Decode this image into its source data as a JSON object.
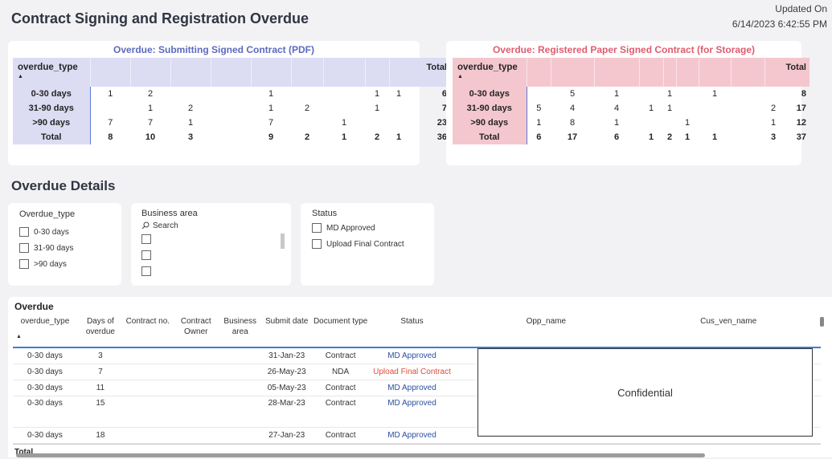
{
  "header": {
    "title": "Contract Signing and Registration Overdue",
    "updated_label": "Updated On",
    "updated_value": "6/14/2023 6:42:55 PM"
  },
  "colors": {
    "blue_header": "#dcdcf3",
    "pink_header": "#f4c7ce",
    "blue_title": "#5b6abf",
    "pink_title": "#e05c6e",
    "status_blue": "#2b4f9f",
    "status_red": "#e04b3a"
  },
  "matrix_pdf": {
    "title": "Overdue: Submitting Signed Contract (PDF)",
    "row_header": "overdue_type",
    "total_label": "Total",
    "rows": [
      {
        "label": "0-30 days",
        "cells": [
          "1",
          "2",
          "",
          "",
          "1",
          "",
          "",
          "1",
          "1"
        ],
        "total": "6"
      },
      {
        "label": "31-90 days",
        "cells": [
          "",
          "1",
          "2",
          "",
          "1",
          "2",
          "",
          "1",
          ""
        ],
        "total": "7"
      },
      {
        "label": ">90 days",
        "cells": [
          "7",
          "7",
          "1",
          "",
          "7",
          "",
          "1",
          "",
          ""
        ],
        "total": "23"
      },
      {
        "label": "Total",
        "cells": [
          "8",
          "10",
          "3",
          "",
          "9",
          "2",
          "1",
          "2",
          "1"
        ],
        "total": "36"
      }
    ]
  },
  "matrix_paper": {
    "title": "Overdue: Registered Paper Signed Contract (for Storage)",
    "row_header": "overdue_type",
    "total_label": "Total",
    "rows": [
      {
        "label": "0-30 days",
        "cells": [
          "",
          "5",
          "1",
          "",
          "1",
          "",
          "1",
          "",
          ""
        ],
        "total": "8"
      },
      {
        "label": "31-90 days",
        "cells": [
          "5",
          "4",
          "4",
          "1",
          "1",
          "",
          "",
          "",
          "2"
        ],
        "total": "17"
      },
      {
        "label": ">90 days",
        "cells": [
          "1",
          "8",
          "1",
          "",
          "",
          "1",
          "",
          "",
          "1"
        ],
        "total": "12"
      },
      {
        "label": "Total",
        "cells": [
          "6",
          "17",
          "6",
          "1",
          "2",
          "1",
          "1",
          "",
          "3"
        ],
        "total": "37"
      }
    ]
  },
  "details_title": "Overdue Details",
  "slicers": {
    "overdue_type": {
      "title": "Overdue_type",
      "options": [
        "0-30 days",
        "31-90 days",
        ">90 days"
      ]
    },
    "business_area": {
      "title": "Business area",
      "search_placeholder": "Search"
    },
    "status": {
      "title": "Status",
      "options": [
        "MD Approved",
        "Upload Final Contract"
      ]
    }
  },
  "overdue_table": {
    "title": "Overdue",
    "columns": [
      "overdue_type",
      "Days of overdue",
      "Contract no.",
      "Contract Owner",
      "Business area",
      "Submit date",
      "Document type",
      "Status",
      "Opp_name",
      "Cus_ven_name"
    ],
    "rows": [
      {
        "overdue_type": "0-30 days",
        "days": "3",
        "submit_date": "31-Jan-23",
        "doc_type": "Contract",
        "status": "MD Approved",
        "status_color": "blue"
      },
      {
        "overdue_type": "0-30 days",
        "days": "7",
        "submit_date": "26-May-23",
        "doc_type": "NDA",
        "status": "Upload Final Contract",
        "status_color": "red"
      },
      {
        "overdue_type": "0-30 days",
        "days": "11",
        "submit_date": "05-May-23",
        "doc_type": "Contract",
        "status": "MD Approved",
        "status_color": "blue"
      },
      {
        "overdue_type": "0-30 days",
        "days": "15",
        "submit_date": "28-Mar-23",
        "doc_type": "Contract",
        "status": "MD Approved",
        "status_color": "blue"
      },
      {
        "overdue_type": "0-30 days",
        "days": "18",
        "submit_date": "27-Jan-23",
        "doc_type": "Contract",
        "status": "MD Approved",
        "status_color": "blue"
      }
    ],
    "total_label": "Total",
    "confidential_label": "Confidential"
  }
}
